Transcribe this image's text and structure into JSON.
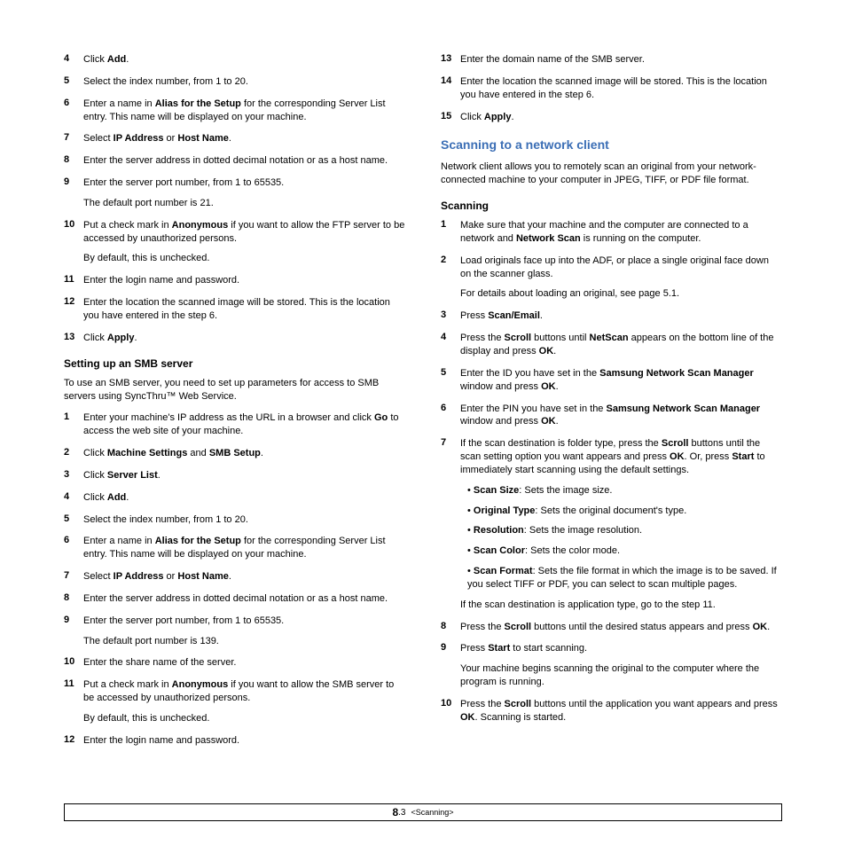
{
  "left": {
    "steps_a": [
      {
        "n": "4",
        "t": "Click <b>Add</b>."
      },
      {
        "n": "5",
        "t": "Select the index number, from 1 to 20."
      },
      {
        "n": "6",
        "t": "Enter a name in <b>Alias for the Setup</b> for the corresponding Server List entry. This name will be displayed on your machine."
      },
      {
        "n": "7",
        "t": "Select <b>IP Address</b> or <b>Host Name</b>."
      },
      {
        "n": "8",
        "t": "Enter the server address in dotted decimal notation or as a host name."
      },
      {
        "n": "9",
        "t": "Enter the server port number, from 1 to 65535.",
        "sub": "The default port number is 21."
      },
      {
        "n": "10",
        "t": "Put a check mark in <b>Anonymous</b> if you want to allow the FTP server to be accessed by unauthorized persons.",
        "sub": "By default, this is unchecked."
      },
      {
        "n": "11",
        "t": "Enter the login name and password."
      },
      {
        "n": "12",
        "t": "Enter the location the scanned image will be stored. This is the location you have entered in the step 6."
      },
      {
        "n": "13",
        "t": "Click <b>Apply</b>."
      }
    ],
    "smb_head": "Setting up an SMB server",
    "smb_intro": "To use an SMB server, you need to set up parameters for access to SMB servers using SyncThru™ Web Service.",
    "steps_b": [
      {
        "n": "1",
        "t": "Enter your machine's IP address as the URL in a browser and click <b>Go</b> to access the web site of your machine."
      },
      {
        "n": "2",
        "t": "Click <b>Machine Settings</b> and <b>SMB Setup</b>."
      },
      {
        "n": "3",
        "t": "Click <b>Server List</b>."
      },
      {
        "n": "4",
        "t": "Click <b>Add</b>."
      },
      {
        "n": "5",
        "t": "Select the index number, from 1 to 20."
      },
      {
        "n": "6",
        "t": "Enter a name in <b>Alias for the Setup</b> for the corresponding Server List entry. This name will be displayed on your machine."
      },
      {
        "n": "7",
        "t": "Select <b>IP Address</b> or <b>Host Name</b>."
      },
      {
        "n": "8",
        "t": "Enter the server address in dotted decimal notation or as a host name."
      },
      {
        "n": "9",
        "t": "Enter the server port number, from 1 to 65535.",
        "sub": "The default port number is 139."
      },
      {
        "n": "10",
        "t": "Enter the share name of the server."
      },
      {
        "n": "11",
        "t": "Put a check mark in <b>Anonymous</b> if you want to allow the SMB server to be accessed by unauthorized persons.",
        "sub": "By default, this is unchecked."
      },
      {
        "n": "12",
        "t": "Enter the login name and password."
      }
    ]
  },
  "right": {
    "steps_c": [
      {
        "n": "13",
        "t": "Enter the domain name of the SMB server."
      },
      {
        "n": "14",
        "t": "Enter the location the scanned image will be stored. This is the location you have entered in the step 6."
      },
      {
        "n": "15",
        "t": "Click <b>Apply</b>."
      }
    ],
    "nc_head": "Scanning to a network client",
    "nc_intro": "Network client allows you to remotely scan an original from your network-connected machine to your computer in JPEG, TIFF, or PDF file format.",
    "scan_head": "Scanning",
    "steps_d": [
      {
        "n": "1",
        "t": "Make sure that your machine and the computer are connected to a network and <b>Network Scan</b> is running on the computer."
      },
      {
        "n": "2",
        "t": "Load originals face up into the ADF, or place a single original face down on the scanner glass.",
        "sub": "For details about loading an original, see page 5.1."
      },
      {
        "n": "3",
        "t": "Press <b>Scan/Email</b>."
      },
      {
        "n": "4",
        "t": "Press the <b>Scroll</b> buttons until <b>NetScan</b> appears on the bottom line of the display and press <b>OK</b>."
      },
      {
        "n": "5",
        "t": "Enter the ID you have set in the <b>Samsung Network Scan Manager</b> window and press <b>OK</b>."
      },
      {
        "n": "6",
        "t": "Enter the PIN you have set in the <b>Samsung Network Scan Manager</b> window and press <b>OK</b>."
      },
      {
        "n": "7",
        "t": "If the scan destination is folder type, press the <b>Scroll</b> buttons until the scan setting option you want appears and press <b>OK</b>. Or, press <b>Start</b> to immediately start scanning using the default settings.",
        "bullets": [
          "<b>Scan Size</b>: Sets the image size.",
          "<b>Original Type</b>: Sets the original document's type.",
          "<b>Resolution</b>: Sets the image resolution.",
          "<b>Scan Color</b>: Sets the color mode.",
          "<b>Scan Format</b>: Sets the file format in which the image is to be saved. If you select TIFF or PDF, you can select to scan multiple pages."
        ],
        "sub": "If the scan destination is application type, go to the step 11."
      },
      {
        "n": "8",
        "t": "Press the <b>Scroll</b> buttons until the desired status appears and press <b>OK</b>."
      },
      {
        "n": "9",
        "t": "Press <b>Start</b> to start scanning.",
        "sub": "Your machine begins scanning the original to the computer where the program is running."
      },
      {
        "n": "10",
        "t": "Press the <b>Scroll</b> buttons until the application you want appears and press <b>OK</b>. Scanning is started."
      }
    ]
  },
  "footer": {
    "page": "8",
    "sub": ".3",
    "chapter": "<Scanning>"
  }
}
